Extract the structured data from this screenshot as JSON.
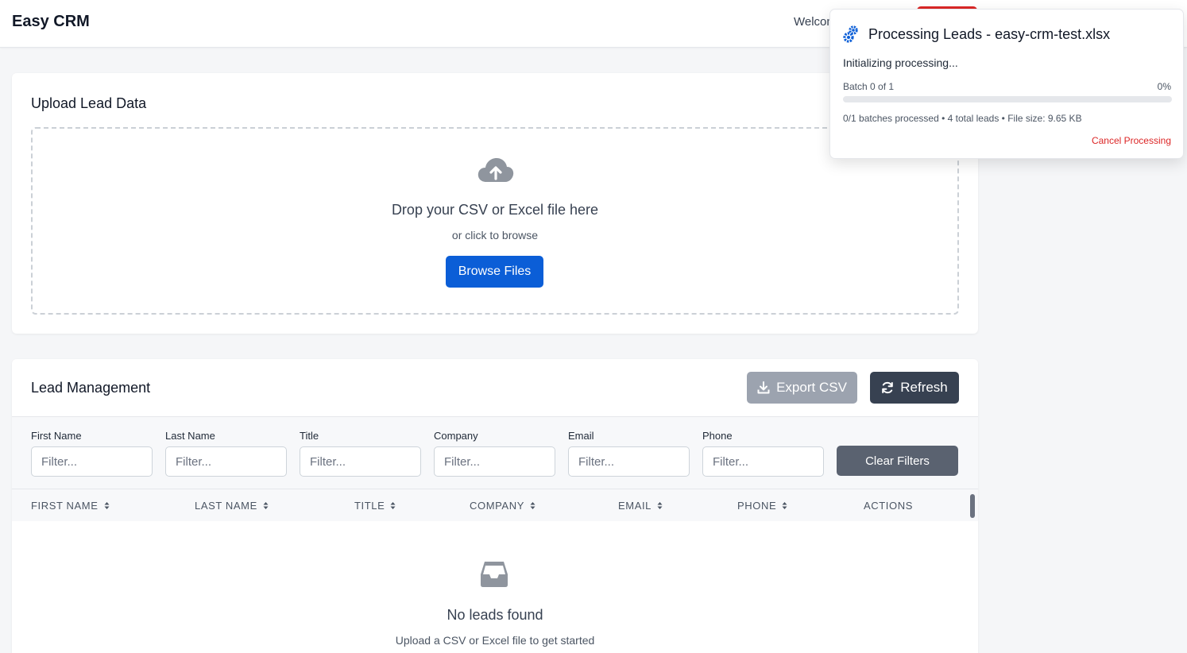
{
  "navbar": {
    "brand": "Easy CRM",
    "welcome": "Welcome"
  },
  "upload": {
    "title": "Upload Lead Data",
    "drop_text": "Drop your CSV or Excel file here",
    "sub_text": "or click to browse",
    "browse_label": "Browse Files"
  },
  "leads": {
    "title": "Lead Management",
    "export_label": "Export CSV",
    "refresh_label": "Refresh",
    "filters": [
      {
        "label": "First Name",
        "placeholder": "Filter..."
      },
      {
        "label": "Last Name",
        "placeholder": "Filter..."
      },
      {
        "label": "Title",
        "placeholder": "Filter..."
      },
      {
        "label": "Company",
        "placeholder": "Filter..."
      },
      {
        "label": "Email",
        "placeholder": "Filter..."
      },
      {
        "label": "Phone",
        "placeholder": "Filter..."
      }
    ],
    "clear_label": "Clear Filters",
    "columns": [
      "FIRST NAME",
      "LAST NAME",
      "TITLE",
      "COMPANY",
      "EMAIL",
      "PHONE",
      "ACTIONS"
    ],
    "empty_title": "No leads found",
    "empty_sub": "Upload a CSV or Excel file to get started"
  },
  "popup": {
    "title": "Processing Leads - easy-crm-test.xlsx",
    "status": "Initializing processing...",
    "batch": "Batch 0 of 1",
    "percent": "0%",
    "progress": 0,
    "stats": "0/1 batches processed • 4 total leads • File size: 9.65 KB",
    "cancel_label": "Cancel Processing"
  },
  "colors": {
    "primary": "#0b5ed7",
    "danger": "#dc2626",
    "dark": "#374151",
    "muted": "#9ca3af"
  }
}
